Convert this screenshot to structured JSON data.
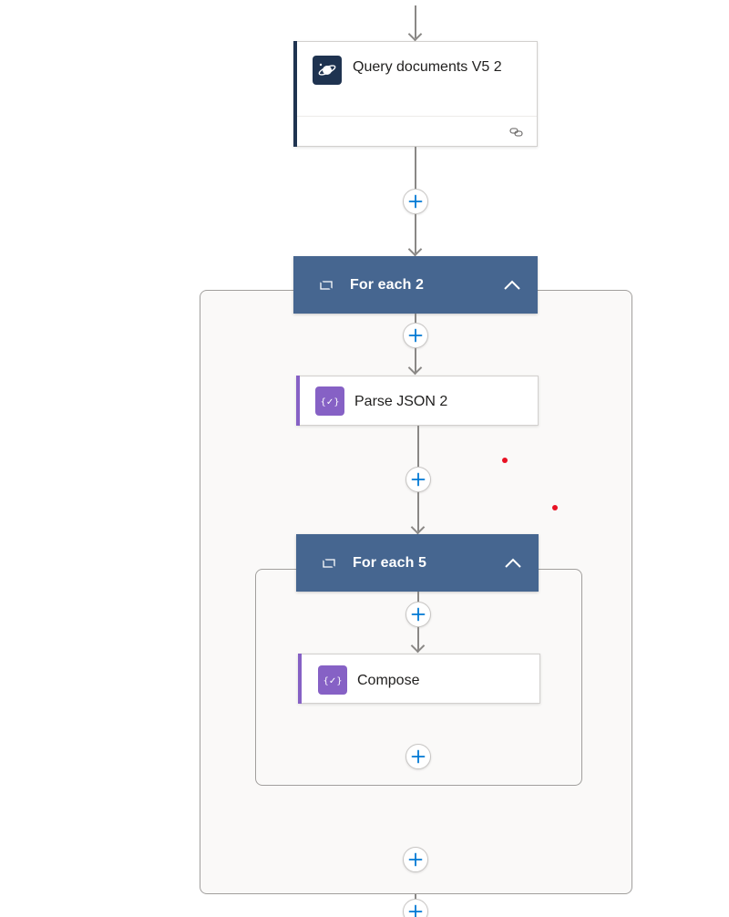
{
  "colors": {
    "connector": "#8a8886",
    "scope_header": "#466690",
    "plus_icon": "#0078d4",
    "cosmos_accent": "#1f3350",
    "data_ops_accent": "#8661c5"
  },
  "actions": {
    "query_documents": {
      "title": "Query documents V5 2",
      "icon": "cosmos-db-planet-icon",
      "footer_icon": "link-chain-icon"
    },
    "parse_json": {
      "title": "Parse JSON 2",
      "icon": "data-operation-braces-icon"
    },
    "compose": {
      "title": "Compose",
      "icon": "data-operation-braces-icon"
    }
  },
  "scopes": {
    "for_each_2": {
      "title": "For each 2",
      "icon": "loop-icon",
      "collapse_icon": "chevron-up-icon"
    },
    "for_each_5": {
      "title": "For each 5",
      "icon": "loop-icon",
      "collapse_icon": "chevron-up-icon"
    }
  },
  "insert_step_icon": "plus-icon"
}
